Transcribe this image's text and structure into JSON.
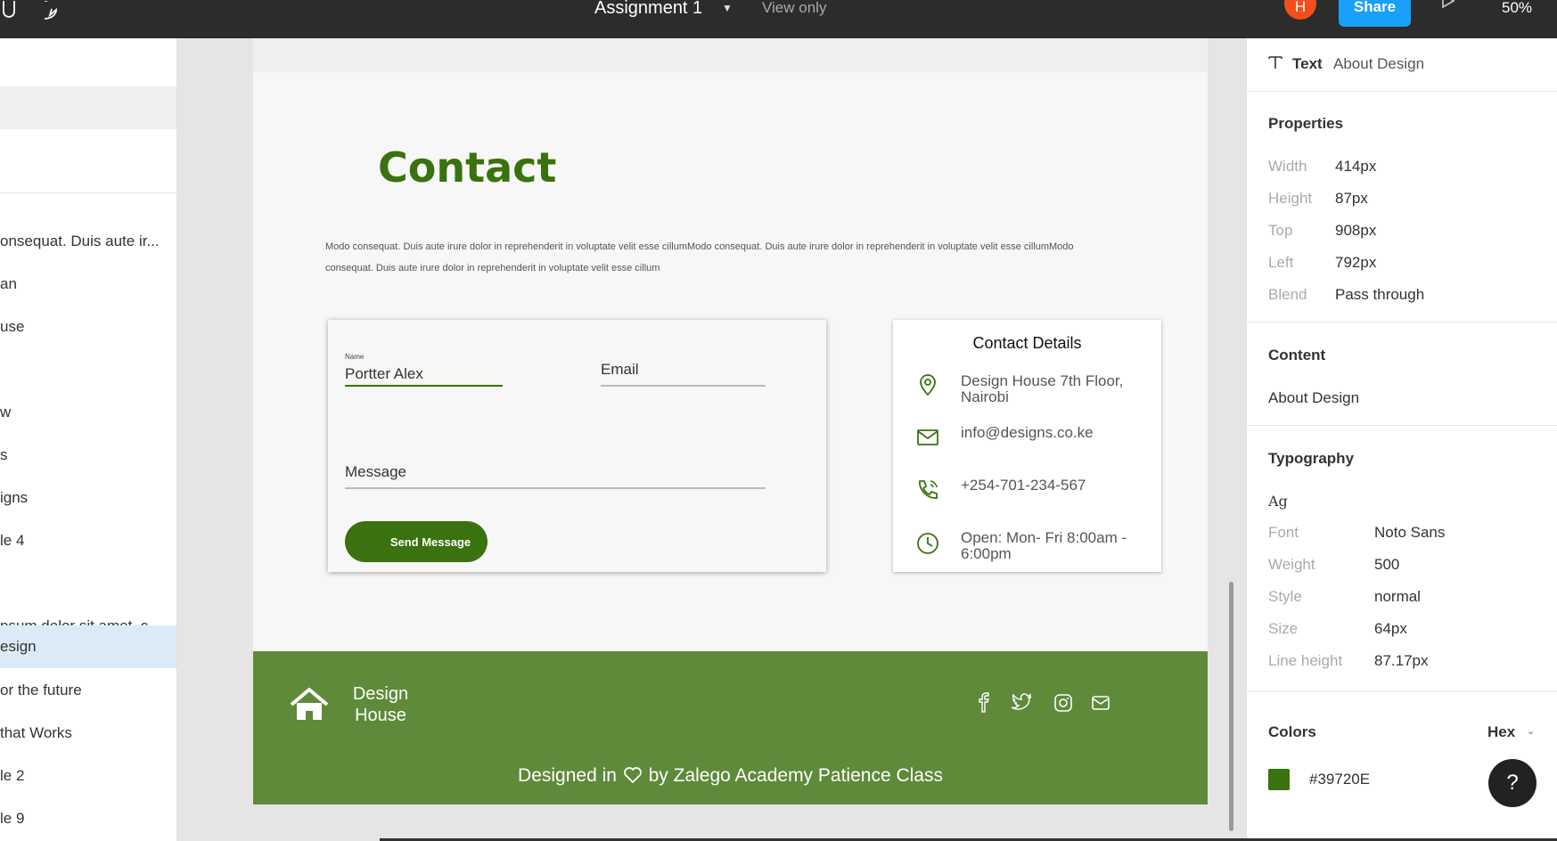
{
  "topbar": {
    "title": "Assignment 1",
    "view_mode": "View only",
    "avatar_initial": "H",
    "share_label": "Share",
    "zoom": "50%"
  },
  "layers": {
    "items": [
      {
        "label": "onsequat. Duis aute ir..."
      },
      {
        "label": "an"
      },
      {
        "label": "use"
      },
      {
        "label": "w"
      },
      {
        "label": "s"
      },
      {
        "label": "igns"
      },
      {
        "label": "le 4"
      },
      {
        "label": "psum dolor sit amet, c..."
      },
      {
        "label": "esign"
      },
      {
        "label": "or the future"
      },
      {
        "label": "that Works"
      },
      {
        "label": "le 2"
      },
      {
        "label": "le 9"
      }
    ]
  },
  "page": {
    "contact_title": "Contact",
    "lorem": "Modo consequat. Duis aute irure dolor in reprehenderit in voluptate velit esse cillumModo consequat. Duis aute irure dolor in reprehenderit in voluptate velit esse cillumModo consequat. Duis aute irure dolor in reprehenderit in voluptate velit esse cillum",
    "form": {
      "name_label": "Name",
      "name_value": "Portter  Alex",
      "email_placeholder": "Email",
      "message_placeholder": "Message",
      "send_label": "Send Message"
    },
    "details": {
      "title": "Contact Details",
      "address": "Design House  7th Floor, Nairobi",
      "email": "info@designs.co.ke",
      "phone": "+254-701-234-567",
      "hours": "Open: Mon- Fri 8:00am - 6:00pm"
    },
    "footer": {
      "brand": "Design House",
      "credit_pre": "Designed in",
      "credit_post": "by Zalego Academy Patience Class"
    }
  },
  "inspector": {
    "layer_type": "Text",
    "layer_name": "About Design",
    "properties_title": "Properties",
    "properties": [
      {
        "label": "Width",
        "value": "414px"
      },
      {
        "label": "Height",
        "value": "87px"
      },
      {
        "label": "Top",
        "value": "908px"
      },
      {
        "label": "Left",
        "value": "792px"
      },
      {
        "label": "Blend",
        "value": "Pass through"
      }
    ],
    "content_title": "Content",
    "content_value": "About Design",
    "typography_title": "Typography",
    "typography_sample": "Ag",
    "typography": [
      {
        "label": "Font",
        "value": "Noto Sans"
      },
      {
        "label": "Weight",
        "value": "500"
      },
      {
        "label": "Style",
        "value": "normal"
      },
      {
        "label": "Size",
        "value": "64px"
      },
      {
        "label": "Line height",
        "value": "87.17px"
      }
    ],
    "colors_title": "Colors",
    "color_format": "Hex",
    "color_value": "#39720E",
    "color_hex": "#39720e",
    "help_label": "?"
  }
}
